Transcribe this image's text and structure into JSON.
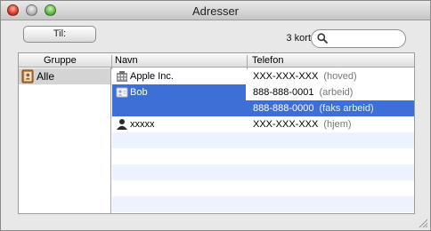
{
  "window": {
    "title": "Adresser"
  },
  "toolbar": {
    "to_button": "Til:",
    "card_count": "3 kort",
    "search_value": ""
  },
  "columns": {
    "group": "Gruppe",
    "name": "Navn",
    "phone": "Telefon"
  },
  "groups": [
    {
      "label": "Alle",
      "selected": true
    }
  ],
  "contacts": [
    {
      "name": "Apple Inc.",
      "icon": "building-icon",
      "phones": [
        {
          "number": "XXX-XXX-XXX",
          "type": "(hoved)"
        }
      ]
    },
    {
      "name": "Bob",
      "icon": "contact-card-icon",
      "selected": true,
      "phones": [
        {
          "number": "888-888-0001",
          "type": "(arbeid)"
        },
        {
          "number": "888-888-0000",
          "type": "(faks arbeid)"
        }
      ]
    },
    {
      "name": "xxxxx",
      "icon": "person-icon",
      "phones": [
        {
          "number": "XXX-XXX-XXX",
          "type": "(hjem)"
        }
      ]
    }
  ],
  "colors": {
    "selection": "#3d6fd6",
    "stripe": "#edf3fe",
    "group_selected": "#d4d4d4"
  }
}
